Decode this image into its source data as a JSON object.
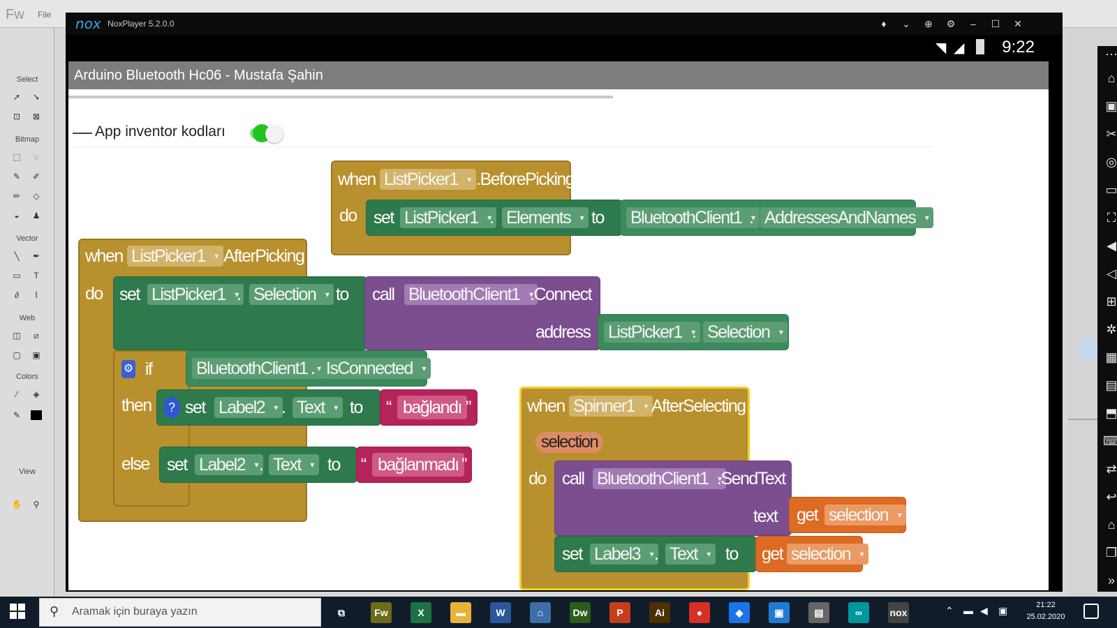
{
  "fireworks": {
    "app_short": "Fw",
    "menu_file": "File",
    "sections": [
      "Select",
      "Bitmap",
      "Vector",
      "Web",
      "Colors",
      "View"
    ]
  },
  "nox": {
    "logo": "nox",
    "title": "NoxPlayer 5.2.0.0"
  },
  "status": {
    "time": "9:22"
  },
  "app": {
    "title": "Arduino Bluetooth Hc06 - Mustafa Şahin",
    "switch_label": "App inventor kodları",
    "switch_on": true
  },
  "blocks": {
    "kw_when": "when",
    "kw_do": "do",
    "kw_set": "set",
    "kw_to": "to",
    "kw_call": "call",
    "kw_get": "get",
    "kw_if": "if",
    "kw_then": "then",
    "kw_else": "else",
    "dot": ".",
    "bp": {
      "component": "ListPicker1",
      "event": ".BeforePicking",
      "set_component": "ListPicker1",
      "set_prop": "Elements",
      "value_component": "BluetoothClient1",
      "value_prop": "AddressesAndNames"
    },
    "ap": {
      "component": "ListPicker1",
      "event": "AfterPicking",
      "set_component": "ListPicker1",
      "set_prop": "Selection",
      "call_component": "BluetoothClient1",
      "call_method": ".Connect",
      "arg_name": "address",
      "arg_component": "ListPicker1",
      "arg_prop": "Selection",
      "if_component": "BluetoothClient1",
      "if_prop": "IsConnected",
      "then_component": "Label2",
      "then_prop": "Text",
      "then_value": "bağlandı",
      "else_component": "Label2",
      "else_prop": "Text",
      "else_value": "bağlanmadı"
    },
    "sp": {
      "component": "Spinner1",
      "event": "AfterSelecting",
      "param": "selection",
      "call_component": "BluetoothClient1",
      "call_method": ".SendText",
      "arg_name": "text",
      "arg_var": "selection",
      "set_component": "Label3",
      "set_prop": "Text",
      "set_var": "selection"
    }
  },
  "taskbar": {
    "search_placeholder": "Aramak için buraya yazın",
    "clock_time": "21:22",
    "clock_date": "25.02.2020",
    "apps": [
      {
        "name": "task-view",
        "glyph": "⧉",
        "color": "#101c2a"
      },
      {
        "name": "fireworks",
        "glyph": "Fw",
        "color": "#6b6b1a"
      },
      {
        "name": "excel",
        "glyph": "X",
        "color": "#1e7145"
      },
      {
        "name": "file-explorer",
        "glyph": "▬",
        "color": "#e8b33a"
      },
      {
        "name": "word",
        "glyph": "W",
        "color": "#2b579a"
      },
      {
        "name": "network",
        "glyph": "⌂",
        "color": "#3c6ea8"
      },
      {
        "name": "dreamweaver",
        "glyph": "Dw",
        "color": "#2b5c19"
      },
      {
        "name": "powerpoint",
        "glyph": "P",
        "color": "#c43e1c"
      },
      {
        "name": "illustrator",
        "glyph": "Ai",
        "color": "#4d3000"
      },
      {
        "name": "chrome",
        "glyph": "●",
        "color": "#d93025"
      },
      {
        "name": "drive",
        "glyph": "◆",
        "color": "#1a73e8"
      },
      {
        "name": "photos",
        "glyph": "▣",
        "color": "#1f7bd1"
      },
      {
        "name": "app-unknown",
        "glyph": "▤",
        "color": "#666666"
      },
      {
        "name": "arduino",
        "glyph": "∞",
        "color": "#00979c"
      },
      {
        "name": "nox",
        "glyph": "nox",
        "color": "#444444"
      }
    ]
  }
}
